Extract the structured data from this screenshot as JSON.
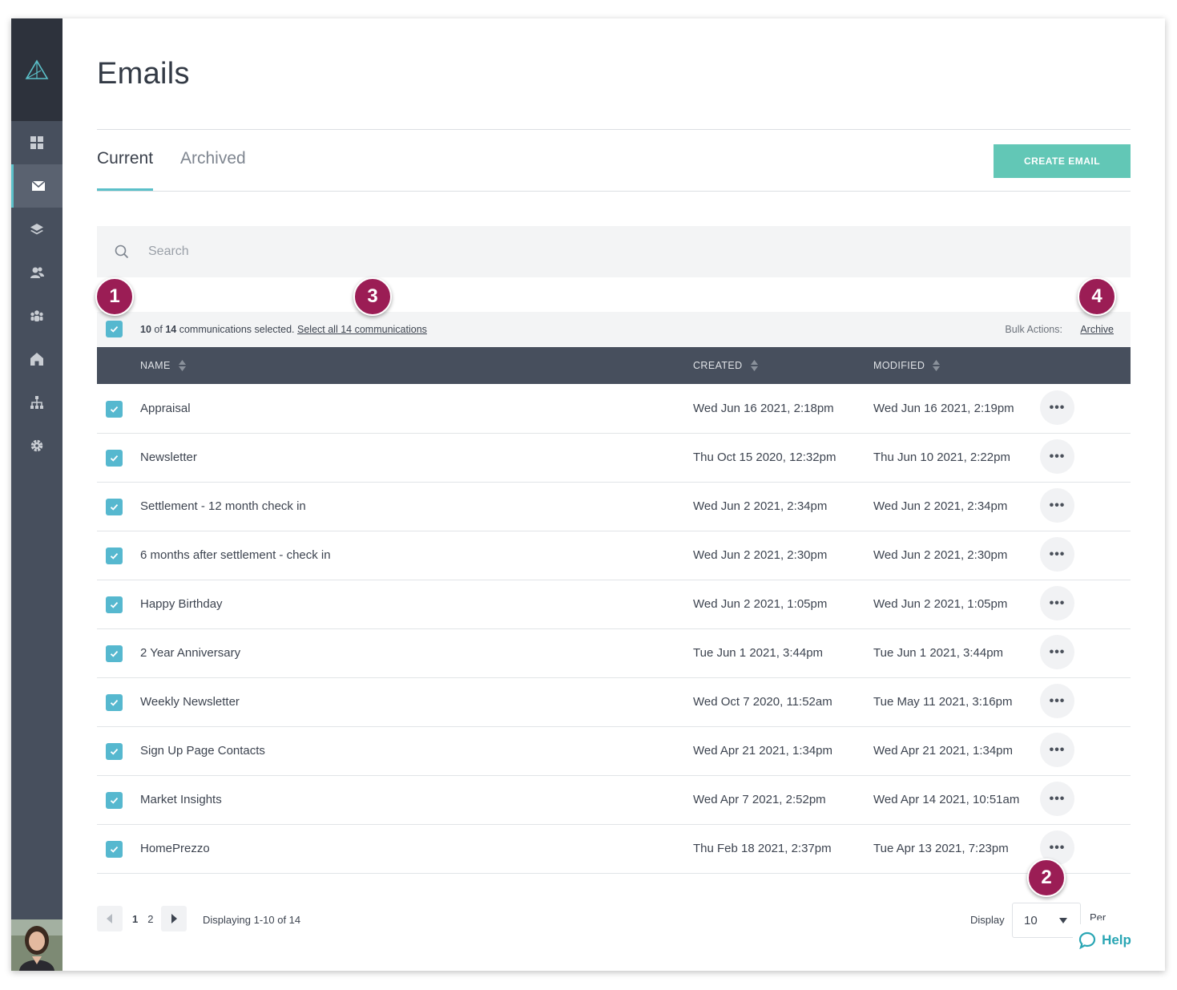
{
  "page": {
    "title": "Emails"
  },
  "tabs": [
    {
      "label": "Current"
    },
    {
      "label": "Archived"
    }
  ],
  "toolbar": {
    "create_label": "CREATE EMAIL"
  },
  "search": {
    "placeholder": "Search"
  },
  "selection": {
    "selected_count": "10",
    "of_label": "of",
    "total_count": "14",
    "suffix": "communications selected.",
    "select_all_label": "Select all 14 communications",
    "bulk_label": "Bulk Actions:",
    "archive_label": "Archive"
  },
  "table": {
    "headers": {
      "name": "NAME",
      "created": "CREATED",
      "modified": "MODIFIED"
    },
    "rows": [
      {
        "name": "Appraisal",
        "created": "Wed Jun 16 2021, 2:18pm",
        "modified": "Wed Jun 16 2021, 2:19pm"
      },
      {
        "name": "Newsletter",
        "created": "Thu Oct 15 2020, 12:32pm",
        "modified": "Thu Jun 10 2021, 2:22pm"
      },
      {
        "name": "Settlement - 12 month check in",
        "created": "Wed Jun 2 2021, 2:34pm",
        "modified": "Wed Jun 2 2021, 2:34pm"
      },
      {
        "name": "6 months after settlement - check in",
        "created": "Wed Jun 2 2021, 2:30pm",
        "modified": "Wed Jun 2 2021, 2:30pm"
      },
      {
        "name": "Happy Birthday",
        "created": "Wed Jun 2 2021, 1:05pm",
        "modified": "Wed Jun 2 2021, 1:05pm"
      },
      {
        "name": "2 Year Anniversary",
        "created": "Tue Jun 1 2021, 3:44pm",
        "modified": "Tue Jun 1 2021, 3:44pm"
      },
      {
        "name": "Weekly Newsletter",
        "created": "Wed Oct 7 2020, 11:52am",
        "modified": "Tue May 11 2021, 3:16pm"
      },
      {
        "name": "Sign Up Page Contacts",
        "created": "Wed Apr 21 2021, 1:34pm",
        "modified": "Wed Apr 21 2021, 1:34pm"
      },
      {
        "name": "Market Insights",
        "created": "Wed Apr 7 2021, 2:52pm",
        "modified": "Wed Apr 14 2021, 10:51am"
      },
      {
        "name": "HomePrezzo",
        "created": "Thu Feb 18 2021, 2:37pm",
        "modified": "Tue Apr 13 2021, 7:23pm"
      }
    ],
    "more_label": "•••"
  },
  "pagination": {
    "pages": [
      "1",
      "2"
    ],
    "displaying": "Displaying 1-10 of 14",
    "display_label": "Display",
    "per_page_value": "10",
    "per_page_label": "Per Page"
  },
  "help": {
    "label": "Help"
  },
  "callouts": [
    "1",
    "2",
    "3",
    "4"
  ],
  "colors": {
    "accent": "#5bc0c9",
    "create_button": "#62c7b6",
    "sidebar": "#474f5d",
    "callout": "#9b1d55",
    "checkbox": "#56b8cf"
  },
  "sidebar": {
    "icons": [
      "logo-icon",
      "dashboard-icon",
      "email-icon",
      "layers-icon",
      "contacts-icon",
      "groups-icon",
      "home-icon",
      "org-chart-icon",
      "settings-icon"
    ]
  }
}
